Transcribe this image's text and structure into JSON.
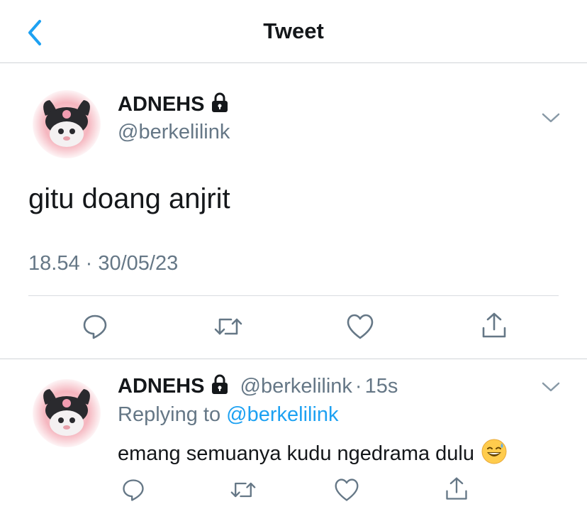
{
  "header": {
    "title": "Tweet",
    "back_icon": "chevron-left-icon"
  },
  "tweet": {
    "name": "ADNEHS",
    "handle": "@berkelilink",
    "text": "gitu doang anjrit",
    "timestamp": "18.54 · 30/05/23",
    "protected_icon": "lock-icon"
  },
  "reply": {
    "name": "ADNEHS",
    "handle": "@berkelilink",
    "separator": "·",
    "time": "15s",
    "replying_prefix": "Replying to",
    "replying_handle": "@berkelilink",
    "text": "emang semuanya kudu ngedrama dulu",
    "emoji": "grinning-sweat-emoji"
  },
  "actions": [
    "reply-icon",
    "retweet-icon",
    "like-icon",
    "share-icon"
  ],
  "colors": {
    "accent": "#1da1f2",
    "muted": "#657786",
    "text": "#14171a",
    "divider": "#d0d4d8"
  }
}
